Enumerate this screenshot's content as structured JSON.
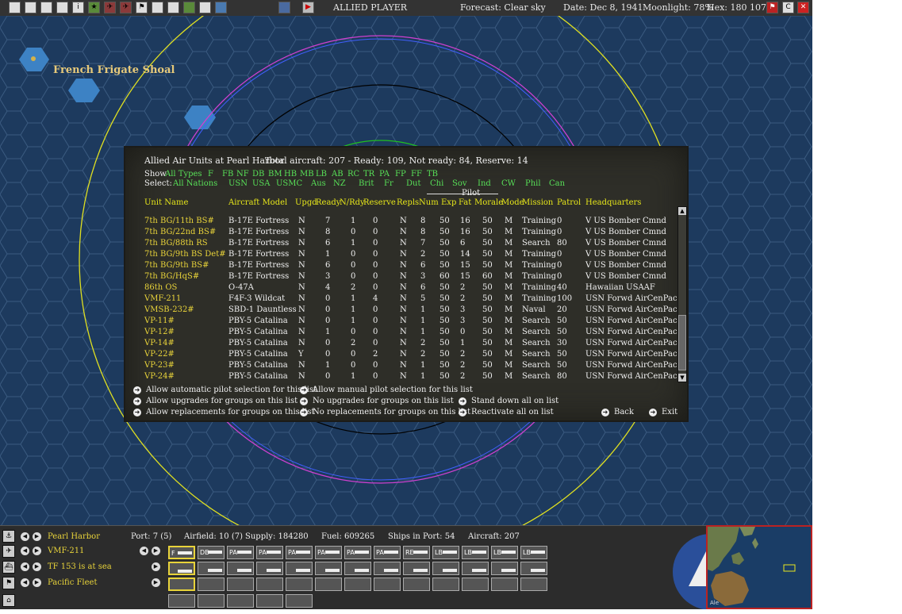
{
  "colors": {
    "text_white": "#f0f0f0",
    "text_green": "#58e058",
    "text_yellow": "#e6e61a",
    "unit_yellow": "#e8d33a",
    "map_sea": "#1d3a5e"
  },
  "topbar": {
    "player": "ALLIED PLAYER",
    "forecast": "Forecast: Clear sky",
    "date": "Date: Dec 8, 1941",
    "moonlight": "Moonlight: 78%",
    "hex": "Hex: 180 107"
  },
  "map": {
    "location_label": "French Frigate Shoal"
  },
  "dialog": {
    "title": "Allied Air Units at Pearl Harbor",
    "totals": "Total aircraft: 207 - Ready: 109, Not ready: 84, Reserve: 14",
    "show_label": "Show",
    "show_types": [
      "All Types",
      "F",
      "FB",
      "NF",
      "DB",
      "BM",
      "HB",
      "MB",
      "LB",
      "AB",
      "RC",
      "TR",
      "PA",
      "FP",
      "FF",
      "TB"
    ],
    "select_label": "Select:",
    "select_nations": [
      "All Nations",
      "USN",
      "USA",
      "USMC",
      "Aus",
      "NZ",
      "Brit",
      "Fr",
      "Dut",
      "Chi",
      "Sov",
      "Ind",
      "CW",
      "Phil",
      "Can"
    ],
    "pilot_group_label": "Pilot",
    "columns": [
      "Unit Name",
      "Aircraft Model",
      "Upgd",
      "Ready",
      "N/Rdy",
      "Reserve",
      "Repls",
      "Num",
      "Exp",
      "Fat",
      "Morale",
      "Mode",
      "Mission",
      "Patrol",
      "Headquarters"
    ],
    "rows": [
      [
        "7th BG/11th BS#",
        "B-17E Fortress",
        "N",
        "7",
        "1",
        "0",
        "N",
        "8",
        "50",
        "16",
        "50",
        "M",
        "Training",
        "0",
        "V US Bomber Cmnd"
      ],
      [
        "7th BG/22nd BS#",
        "B-17E Fortress",
        "N",
        "8",
        "0",
        "0",
        "N",
        "8",
        "50",
        "16",
        "50",
        "M",
        "Training",
        "0",
        "V US Bomber Cmnd"
      ],
      [
        "7th BG/88th RS",
        "B-17E Fortress",
        "N",
        "6",
        "1",
        "0",
        "N",
        "7",
        "50",
        "6",
        "50",
        "M",
        "Search",
        "80",
        "V US Bomber Cmnd"
      ],
      [
        "7th BG/9th BS Det#",
        "B-17E Fortress",
        "N",
        "1",
        "0",
        "0",
        "N",
        "2",
        "50",
        "14",
        "50",
        "M",
        "Training",
        "0",
        "V US Bomber Cmnd"
      ],
      [
        "7th BG/9th BS#",
        "B-17E Fortress",
        "N",
        "6",
        "0",
        "0",
        "N",
        "6",
        "50",
        "15",
        "50",
        "M",
        "Training",
        "0",
        "V US Bomber Cmnd"
      ],
      [
        "7th BG/HqS#",
        "B-17E Fortress",
        "N",
        "3",
        "0",
        "0",
        "N",
        "3",
        "60",
        "15",
        "60",
        "M",
        "Training",
        "0",
        "V US Bomber Cmnd"
      ],
      [
        "86th OS",
        "O-47A",
        "N",
        "4",
        "2",
        "0",
        "N",
        "6",
        "50",
        "2",
        "50",
        "M",
        "Training",
        "40",
        "Hawaiian USAAF"
      ],
      [
        "VMF-211",
        "F4F-3 Wildcat",
        "N",
        "0",
        "1",
        "4",
        "N",
        "5",
        "50",
        "2",
        "50",
        "M",
        "Training",
        "100",
        "USN Forwd AirCenPac"
      ],
      [
        "VMSB-232#",
        "SBD-1 Dauntless",
        "N",
        "0",
        "1",
        "0",
        "N",
        "1",
        "50",
        "3",
        "50",
        "M",
        "Naval",
        "20",
        "USN Forwd AirCenPac"
      ],
      [
        "VP-11#",
        "PBY-5 Catalina",
        "N",
        "0",
        "1",
        "0",
        "N",
        "1",
        "50",
        "3",
        "50",
        "M",
        "Search",
        "50",
        "USN Forwd AirCenPac"
      ],
      [
        "VP-12#",
        "PBY-5 Catalina",
        "N",
        "1",
        "0",
        "0",
        "N",
        "1",
        "50",
        "0",
        "50",
        "M",
        "Search",
        "50",
        "USN Forwd AirCenPac"
      ],
      [
        "VP-14#",
        "PBY-5 Catalina",
        "N",
        "0",
        "2",
        "0",
        "N",
        "2",
        "50",
        "1",
        "50",
        "M",
        "Search",
        "30",
        "USN Forwd AirCenPac"
      ],
      [
        "VP-22#",
        "PBY-5 Catalina",
        "Y",
        "0",
        "0",
        "2",
        "N",
        "2",
        "50",
        "2",
        "50",
        "M",
        "Search",
        "50",
        "USN Forwd AirCenPac"
      ],
      [
        "VP-23#",
        "PBY-5 Catalina",
        "N",
        "1",
        "0",
        "0",
        "N",
        "1",
        "50",
        "2",
        "50",
        "M",
        "Search",
        "50",
        "USN Forwd AirCenPac"
      ],
      [
        "VP-24#",
        "PBY-5 Catalina",
        "N",
        "0",
        "1",
        "0",
        "N",
        "1",
        "50",
        "2",
        "50",
        "M",
        "Search",
        "80",
        "USN Forwd AirCenPac"
      ]
    ],
    "options": {
      "auto_pilot": "Allow automatic pilot selection for this list",
      "manual_pilot": "Allow manual pilot selection for this list",
      "allow_upgrades": "Allow upgrades for groups on this list",
      "no_upgrades": "No upgrades for groups on this list",
      "stand_down": "Stand down all on list",
      "allow_repls": "Allow replacements for groups on this list",
      "no_repls": "No replacements for groups on this list",
      "reactivate": "Reactivate all on list",
      "back": "Back",
      "exit": "Exit"
    }
  },
  "bottom": {
    "base_name": "Pearl Harbor",
    "port": "Port: 7 (5)",
    "airfield": "Airfield: 10 (7)",
    "supply": "Supply: 184280",
    "fuel": "Fuel: 609265",
    "ships_in_port": "Ships in Port: 54",
    "aircraft": "Aircraft: 207",
    "air_unit": "VMF-211",
    "task_force": "TF 153 is at sea",
    "fleet": "Pacific Fleet",
    "air_slot_labels": [
      "F",
      "DB",
      "PA",
      "PA",
      "PA",
      "PA",
      "PA",
      "PA",
      "RE",
      "LB",
      "LB",
      "LB",
      "LB"
    ]
  },
  "minimap": {
    "corner_label": "Ale"
  }
}
